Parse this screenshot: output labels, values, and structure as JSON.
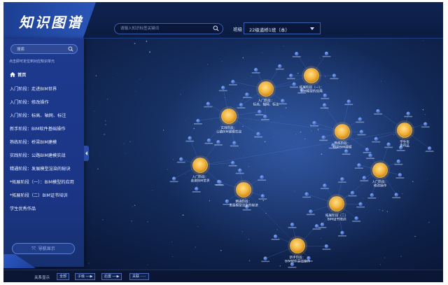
{
  "header": {
    "logo": "知识图谱",
    "search_placeholder": "请输入知识标签关键词",
    "grade_label": "班级",
    "grade_value": "22级道桥1班（本）"
  },
  "sidebar": {
    "search_placeholder": "搜索",
    "hint": "点击即可定位到对应知识单元",
    "home": "首页",
    "items": [
      "入门阶段：走进BIM世界",
      "入门阶段：修改操作",
      "入门阶段：标高、轴网、标注",
      "新手阶段：BIM软件基础操作",
      "熟练阶段：桥梁BIM建模",
      "实践阶段：公路BIM建模实战",
      "精通阶段：发展模型渲染的秘诀",
      "*拓展阶段（一）：BIM模型的应用",
      "*拓展阶段（二）BIM证书培训",
      "学生优秀作品"
    ],
    "guide_button": "导航显示"
  },
  "bottom": {
    "relation_label": "关系显示",
    "buttons": [
      "全部",
      "子级 ──▶",
      "后置 ──▶",
      "关联 ·····"
    ]
  },
  "graph": {
    "hubs": [
      {
        "label": "拓展阶段（一）：BIM模型的应用"
      },
      {
        "label": "入门阶段：标高、轴网、标注"
      },
      {
        "label": "实践阶段：公路BIM建模实战"
      },
      {
        "label": "熟练阶段：桥梁BIM建模"
      },
      {
        "label": "学生优秀作品"
      },
      {
        "label": "入门阶段：走进BIM世界"
      },
      {
        "label": "入门阶段：修改操作"
      },
      {
        "label": "拓展阶段（二）BIM证书培训"
      },
      {
        "label": "精通阶段：发展模型渲染的秘诀"
      },
      {
        "label": "新手阶段：BIM软件基础操作"
      }
    ]
  },
  "colors": {
    "hub": "#f2b33d",
    "leaf": "#3f6fd8",
    "sidebar": "#1d3a8e"
  }
}
